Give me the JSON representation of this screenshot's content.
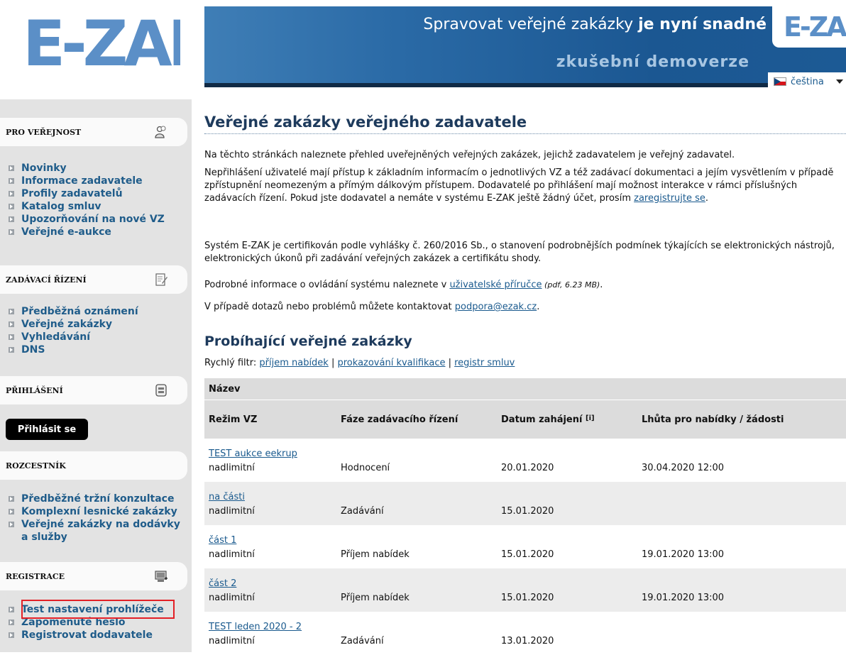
{
  "header": {
    "logo_text": "E-ZAK",
    "tagline_normal": "Spravovat veřejné zakázky ",
    "tagline_bold": "je nyní snadné",
    "subtitle": "zkušební demoverze",
    "mini_logo_text": "E-ZAK",
    "language": "čeština"
  },
  "sidebar": {
    "sections": [
      {
        "title": "PRO VEŘEJNOST",
        "icon": "people-icon",
        "items": [
          "Novinky",
          "Informace zadavatele",
          "Profily zadavatelů",
          "Katalog smluv",
          "Upozorňování na nové VZ",
          "Veřejné e-aukce"
        ]
      },
      {
        "title": "ZADÁVACÍ ŘÍZENÍ",
        "icon": "document-edit-icon",
        "items": [
          "Předběžná oznámení",
          "Veřejné zakázky",
          "Vyhledávání",
          "DNS"
        ]
      },
      {
        "title": "PŘIHLÁŠENÍ",
        "icon": "lock-icon",
        "button": "Přihlásit se"
      },
      {
        "title": "ROZCESTNÍK",
        "items": [
          "Předběžné tržní konzultace",
          "Komplexní lesnické zakázky",
          "Veřejné zakázky na dodávky a služby"
        ]
      },
      {
        "title": "REGISTRACE",
        "icon": "computer-add-icon",
        "items": [
          "Test nastavení prohlížeče",
          "Zapomenuté heslo",
          "Registrovat dodavatele"
        ]
      }
    ]
  },
  "main": {
    "title": "Veřejné zakázky veřejného zadavatele",
    "p1": "Na těchto stránkách naleznete přehled uveřejněných veřejných zakázek, jejichž zadavatelem je veřejný zadavatel.",
    "p2_text": "Nepřihlášení uživatelé mají přístup k základním informacím o jednotlivých VZ a též zadávací dokumentaci a jejím vysvětlením v případě zpřístupnění neomezeným a přímým dálkovým přístupem. Dodavatelé po přihlášení mají možnost interakce v rámci příslušných zadávacích řízení. Pokud jste dodavatel a nemáte v systému E-ZAK ještě žádný účet, prosím ",
    "p2_link": "zaregistrujte se",
    "p2_end": ".",
    "p3": "Systém E-ZAK je certifikován podle vyhlášky č. 260/2016 Sb., o stanovení podrobnějších podmínek týkajících se elektronických nástrojů, elektronických úkonů při zadávání veřejných zakázek a certifikátu shody.",
    "p4_text": "Podrobné informace o ovládání systému naleznete v ",
    "p4_link": "uživatelské příručce",
    "p4_note": " (pdf, 6.23 MB)",
    "p4_end": ".",
    "p5_text": "V případě dotazů nebo problémů můžete kontaktovat ",
    "p5_link": "podpora@ezak.cz",
    "p5_end": ".",
    "section_title": "Probíhající veřejné zakázky",
    "filter_label": "Rychlý filtr: ",
    "filters": [
      "příjem nabídek",
      "prokazování kvalifikace",
      "registr smluv"
    ],
    "filter_sep": " | "
  },
  "table": {
    "header_name": "Název",
    "headers": [
      "Režim VZ",
      "Fáze zadávacího řízení",
      "Datum zahájení",
      "Lhůta pro nabídky / žádosti"
    ],
    "info_mark": "[i]",
    "rows": [
      {
        "name": "TEST aukce eekrup",
        "mode": "nadlimitní",
        "phase": "Hodnocení",
        "start": "20.01.2020",
        "deadline": "30.04.2020 12:00"
      },
      {
        "name": "na části",
        "mode": "nadlimitní",
        "phase": "Zadávání",
        "start": "15.01.2020",
        "deadline": ""
      },
      {
        "name": "část 1",
        "mode": "nadlimitní",
        "phase": "Příjem nabídek",
        "start": "15.01.2020",
        "deadline": "19.01.2020 13:00"
      },
      {
        "name": "část 2",
        "mode": "nadlimitní",
        "phase": "Příjem nabídek",
        "start": "15.01.2020",
        "deadline": "19.01.2020 13:00"
      },
      {
        "name": "TEST leden 2020 - 2",
        "mode": "nadlimitní",
        "phase": "Zadávání",
        "start": "13.01.2020",
        "deadline": ""
      }
    ]
  },
  "colors": {
    "banner": "#1b5792",
    "link": "#1a5a8e",
    "highlight": "#e32026",
    "sidebar_bg": "#e3e3e3"
  }
}
